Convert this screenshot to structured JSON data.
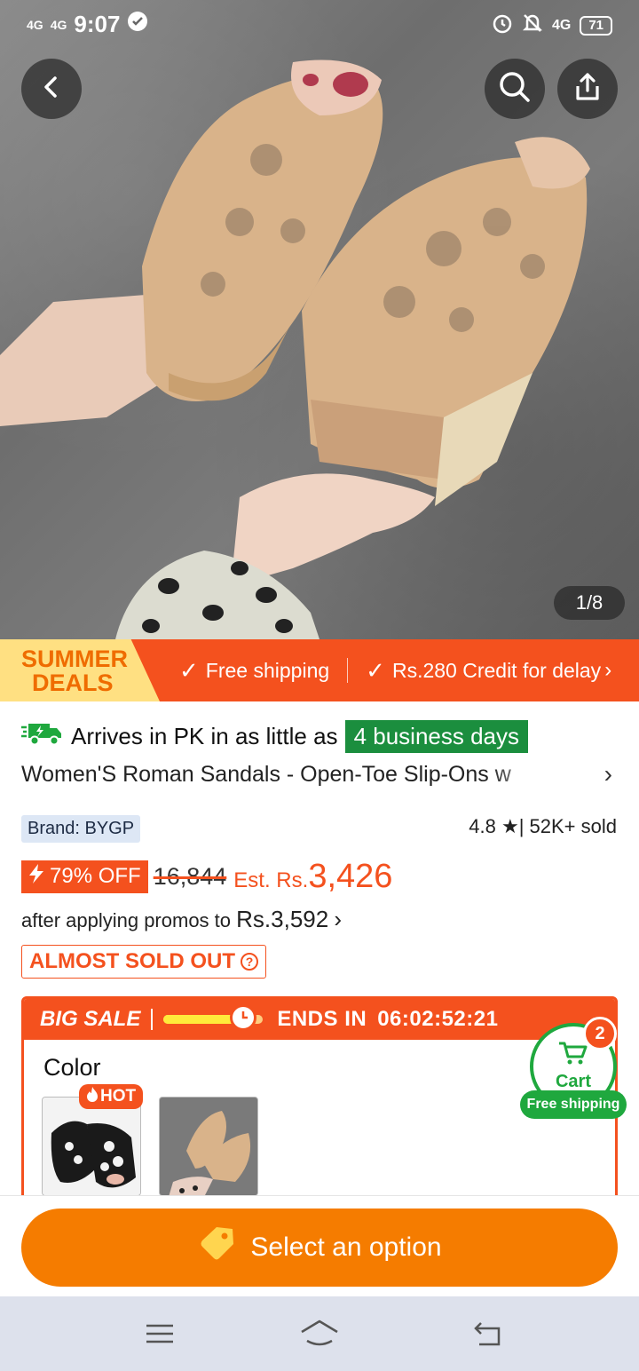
{
  "status_bar": {
    "network_1": "4G",
    "network_2": "4G",
    "time": "9:07",
    "network_right": "4G",
    "battery": "71"
  },
  "gallery": {
    "counter": "1/8",
    "icons": {
      "back": "back-arrow-icon",
      "search": "search-icon",
      "share": "share-icon"
    }
  },
  "promo_bar": {
    "event_line1": "SUMMER",
    "event_line2": "DEALS",
    "perk_1": "Free shipping",
    "perk_2": "Rs.280 Credit for delay",
    "colors": {
      "bar": "#f4511e",
      "event_bg": "#ffe082",
      "event_text": "#ef6c00"
    }
  },
  "delivery": {
    "text": "Arrives in PK in as little as",
    "days": "4 business days",
    "badge_color": "#1b8e3e"
  },
  "product": {
    "title": "Women'S Roman Sandals - Open-Toe Slip-Ons w",
    "brand": "Brand: BYGP",
    "rating": "4.8",
    "sold": "| 52K+ sold"
  },
  "price": {
    "discount": "79% OFF",
    "original": "16,844",
    "est_label": "Est. Rs.",
    "est_value": "3,426",
    "promo_text": "after applying promos to",
    "promo_price": "Rs.3,592",
    "stock_label": "ALMOST SOLD OUT"
  },
  "sale": {
    "label": "BIG SALE",
    "progress_fraction": 0.8,
    "ends_label": "ENDS IN",
    "countdown": "06:02:52:21"
  },
  "variants": {
    "heading": "Color",
    "hot_badge": "HOT"
  },
  "cart": {
    "label": "Cart",
    "count": "2",
    "shipping_badge": "Free shipping",
    "color": "#1fa83e"
  },
  "cta": {
    "label": "Select an option",
    "color": "#f57c00"
  }
}
